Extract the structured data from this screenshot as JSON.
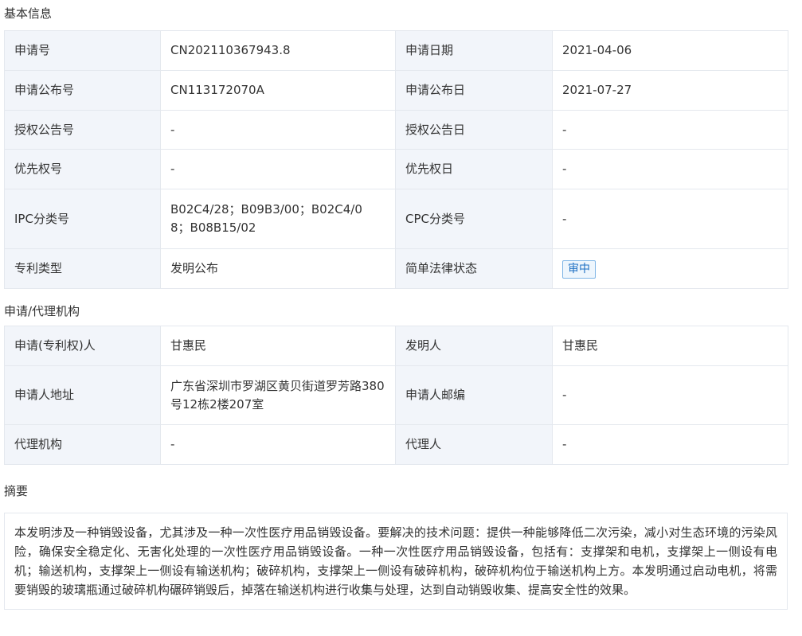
{
  "sections": {
    "basic": "基本信息",
    "agency": "申请/代理机构",
    "abstract": "摘要"
  },
  "basic_info": {
    "app_no_label": "申请号",
    "app_no": "CN202110367943.8",
    "app_date_label": "申请日期",
    "app_date": "2021-04-06",
    "pub_no_label": "申请公布号",
    "pub_no": "CN113172070A",
    "pub_date_label": "申请公布日",
    "pub_date": "2021-07-27",
    "grant_no_label": "授权公告号",
    "grant_no": "-",
    "grant_date_label": "授权公告日",
    "grant_date": "-",
    "priority_no_label": "优先权号",
    "priority_no": "-",
    "priority_date_label": "优先权日",
    "priority_date": "-",
    "ipc_label": "IPC分类号",
    "ipc": "B02C4/28；B09B3/00；B02C4/08；B08B15/02",
    "cpc_label": "CPC分类号",
    "cpc": "-",
    "type_label": "专利类型",
    "type": "发明公布",
    "status_label": "简单法律状态",
    "status": "审中"
  },
  "agency_info": {
    "applicant_label": "申请(专利权)人",
    "applicant": "甘惠民",
    "inventor_label": "发明人",
    "inventor": "甘惠民",
    "address_label": "申请人地址",
    "address": "广东省深圳市罗湖区黄贝街道罗芳路380号12栋2楼207室",
    "postcode_label": "申请人邮编",
    "postcode": "-",
    "agency_label": "代理机构",
    "agency": "-",
    "agent_label": "代理人",
    "agent": "-"
  },
  "abstract_text": "本发明涉及一种销毁设备，尤其涉及一种一次性医疗用品销毁设备。要解决的技术问题：提供一种能够降低二次污染，减小对生态环境的污染风险，确保安全稳定化、无害化处理的一次性医疗用品销毁设备。一种一次性医疗用品销毁设备，包括有：支撑架和电机，支撑架上一侧设有电机；输送机构，支撑架上一侧设有输送机构；破碎机构，支撑架上一侧设有破碎机构，破碎机构位于输送机构上方。本发明通过启动电机，将需要销毁的玻璃瓶通过破碎机构碾碎销毁后，掉落在输送机构进行收集与处理，达到自动销毁收集、提高安全性的效果。"
}
